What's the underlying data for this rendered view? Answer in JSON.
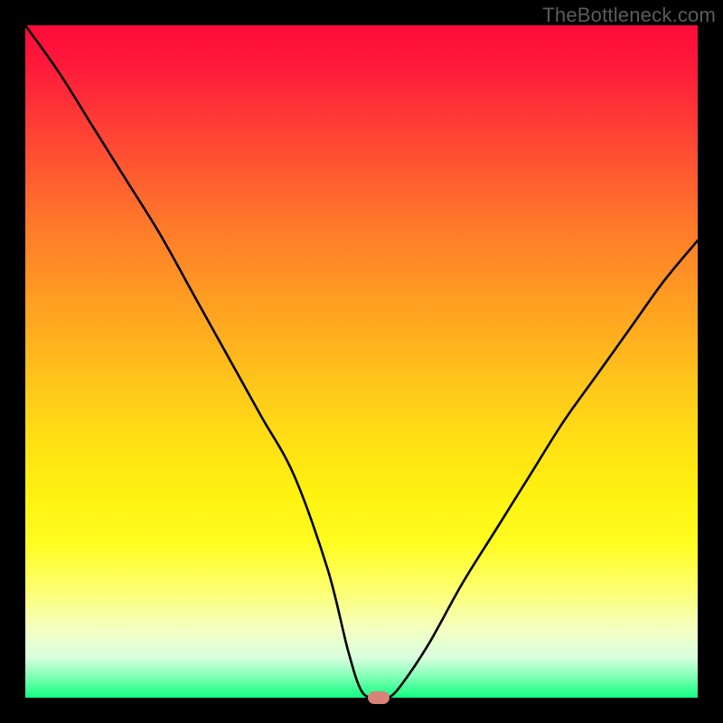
{
  "watermark": "TheBottleneck.com",
  "chart_data": {
    "type": "line",
    "title": "",
    "xlabel": "",
    "ylabel": "",
    "xlim": [
      0,
      100
    ],
    "ylim": [
      0,
      100
    ],
    "grid": false,
    "legend": false,
    "series": [
      {
        "name": "bottleneck-curve",
        "x": [
          0,
          5,
          10,
          15,
          20,
          25,
          30,
          35,
          40,
          45,
          48,
          50,
          52,
          54,
          56,
          60,
          65,
          70,
          75,
          80,
          85,
          90,
          95,
          100
        ],
        "values": [
          100,
          93,
          85,
          77,
          69,
          60,
          51,
          42,
          33,
          19,
          7,
          1,
          0,
          0,
          2,
          8,
          17,
          25,
          33,
          41,
          48,
          55,
          62,
          68
        ]
      }
    ],
    "background_gradient": {
      "top": "#ff0a3a",
      "mid": "#ffe014",
      "bottom": "#10ff82"
    },
    "marker": {
      "x": 52.5,
      "y": 0,
      "color": "#d98277"
    }
  }
}
